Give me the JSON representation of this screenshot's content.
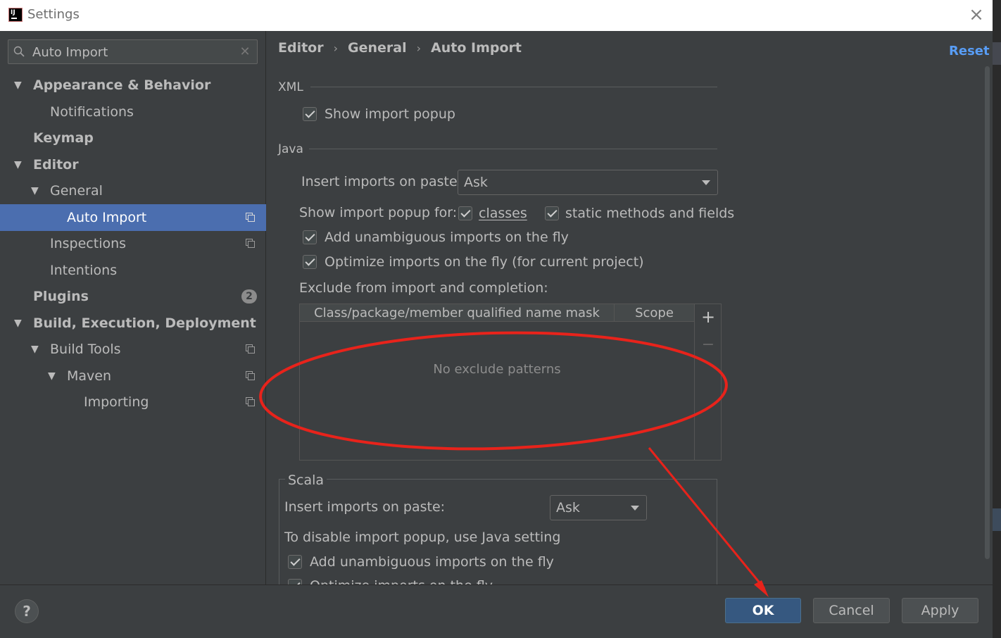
{
  "window": {
    "title": "Settings",
    "app_icon_text": "IJ"
  },
  "sidebar": {
    "search": {
      "value": "Auto Import",
      "placeholder": ""
    },
    "items": [
      {
        "label": "Appearance & Behavior"
      },
      {
        "label": "Notifications"
      },
      {
        "label": "Keymap"
      },
      {
        "label": "Editor"
      },
      {
        "label": "General"
      },
      {
        "label": "Auto Import"
      },
      {
        "label": "Inspections"
      },
      {
        "label": "Intentions"
      },
      {
        "label": "Plugins",
        "badge": "2"
      },
      {
        "label": "Build, Execution, Deployment"
      },
      {
        "label": "Build Tools"
      },
      {
        "label": "Maven"
      },
      {
        "label": "Importing"
      }
    ]
  },
  "breadcrumb": {
    "items": [
      "Editor",
      "General",
      "Auto Import"
    ],
    "separator": "›"
  },
  "reset_label": "Reset",
  "xml": {
    "title": "XML",
    "show_import_popup": {
      "label": "Show import popup",
      "checked": true
    }
  },
  "java": {
    "title": "Java",
    "insert_on_paste": {
      "label": "Insert imports on paste:",
      "value": "Ask"
    },
    "show_popup_for": {
      "label": "Show import popup for:",
      "classes": "classes",
      "static": "static methods and fields"
    },
    "add_unambiguous": {
      "label": "Add unambiguous imports on the fly",
      "checked": true
    },
    "optimize": {
      "label": "Optimize imports on the fly (for current project)",
      "checked": true
    },
    "exclude_label": "Exclude from import and completion:",
    "table": {
      "columns": [
        "Class/package/member qualified name mask",
        "Scope"
      ],
      "empty_text": "No exclude patterns",
      "add": "+",
      "remove": "−"
    }
  },
  "scala": {
    "title": "Scala",
    "insert_on_paste": {
      "label": "Insert imports on paste:",
      "value": "Ask"
    },
    "note": "To disable import popup, use Java setting",
    "add_unambiguous": {
      "label": "Add unambiguous imports on the fly",
      "checked": true
    },
    "optimize_partial": {
      "label": "Optimize imports on the fly",
      "checked": true
    }
  },
  "footer": {
    "help": "?",
    "ok": "OK",
    "cancel": "Cancel",
    "apply": "Apply"
  },
  "colors": {
    "background": "#3c3f41",
    "selection": "#4b6eaf",
    "link": "#589df6",
    "default_button": "#365880",
    "annotation": "#e8231b"
  }
}
